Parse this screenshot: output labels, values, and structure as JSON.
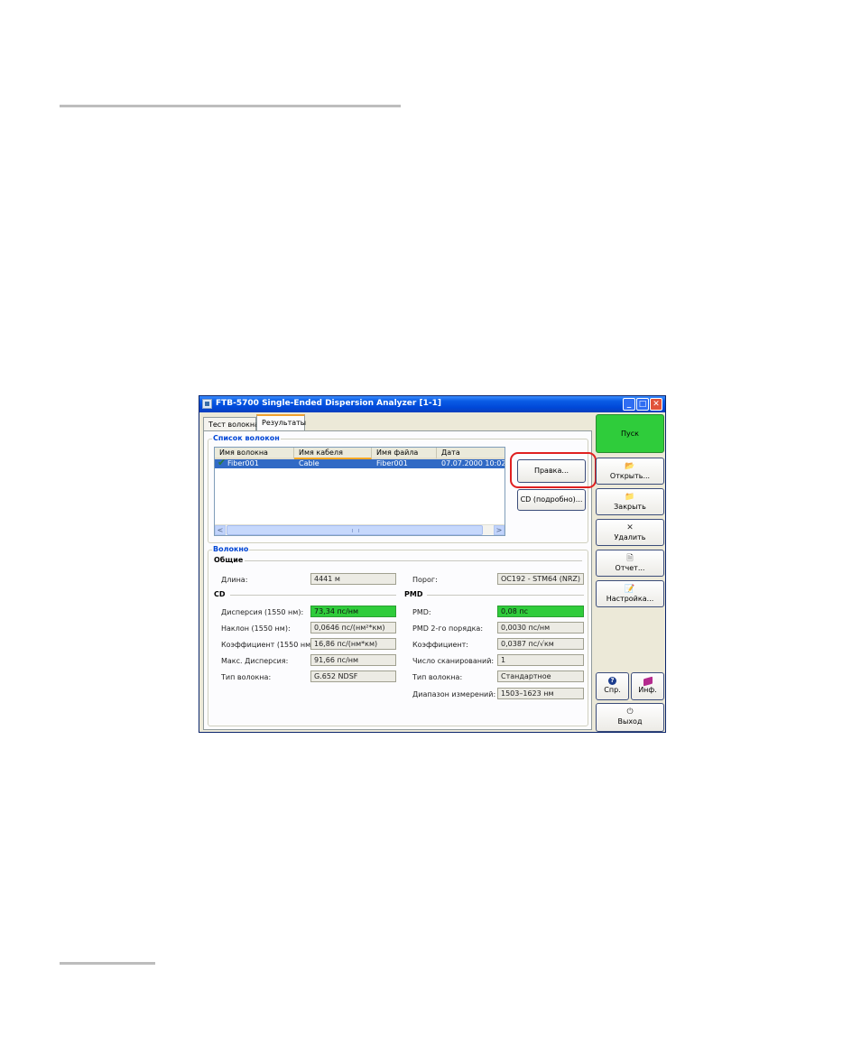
{
  "window": {
    "title": "FTB-5700 Single-Ended Dispersion Analyzer [1-1]",
    "controls": {
      "minimize": "_",
      "maximize": "□",
      "close": "✕"
    }
  },
  "tabs": [
    {
      "label": "Тест волокна"
    },
    {
      "label": "Результаты"
    }
  ],
  "fiber_list": {
    "legend": "Список волокон",
    "columns": [
      "Имя волокна",
      "Имя кабеля",
      "Имя файла",
      "Дата"
    ],
    "rows": [
      {
        "fiber": "Fiber001",
        "cable": "Cable",
        "file": "Fiber001",
        "date": "07.07.2000 10:02:"
      }
    ],
    "scroll_left": "<",
    "scroll_right": ">",
    "edit_label": "Правка...",
    "cd_detail_label": "CD (подробно)..."
  },
  "fiber": {
    "legend": "Волокно",
    "general_title": "Общие",
    "length_label": "Длина:",
    "length_value": "4441 м",
    "threshold_label": "Порог:",
    "threshold_value": "OC192 - STM64 (NRZ)",
    "cd_title": "CD",
    "pmd_title": "PMD",
    "cd": {
      "dispersion_label": "Дисперсия (1550 нм):",
      "dispersion_value": "73,34 пс/нм",
      "slope_label": "Наклон (1550 нм):",
      "slope_value": "0,0646 пс/(нм²*км)",
      "coef_label": "Коэффициент (1550 нм):",
      "coef_value": "16,86 пс/(нм*км)",
      "max_disp_label": "Макс. Дисперсия:",
      "max_disp_value": "91,66 пс/нм",
      "fiber_type_label": "Тип волокна:",
      "fiber_type_value": "G.652 NDSF"
    },
    "pmd": {
      "pmd_label": "PMD:",
      "pmd_value": "0,08 пс",
      "pmd2_label": "PMD 2-го порядка:",
      "pmd2_value": "0,0030 пс/нм",
      "coef_label": "Коэффициент:",
      "coef_value": "0,0387 пс/√км",
      "scans_label": "Число сканирований:",
      "scans_value": "1",
      "fiber_type_label": "Тип волокна:",
      "fiber_type_value": "Стандартное",
      "range_label": "Диапазон измерений:",
      "range_value": "1503–1623 нм"
    }
  },
  "sidebar": {
    "start": "Пуск",
    "open": "Открыть...",
    "close": "Закрыть",
    "delete": "Удалить",
    "report": "Отчет...",
    "settings": "Настройка...",
    "help": "Спр.",
    "info": "Инф.",
    "exit": "Выход"
  },
  "colors": {
    "good_value": "#2fcc3b",
    "start_button": "#2fcc3b",
    "highlight_ring": "#e02020",
    "selected_row": "#316ac5",
    "group_legend": "#0046d5"
  }
}
